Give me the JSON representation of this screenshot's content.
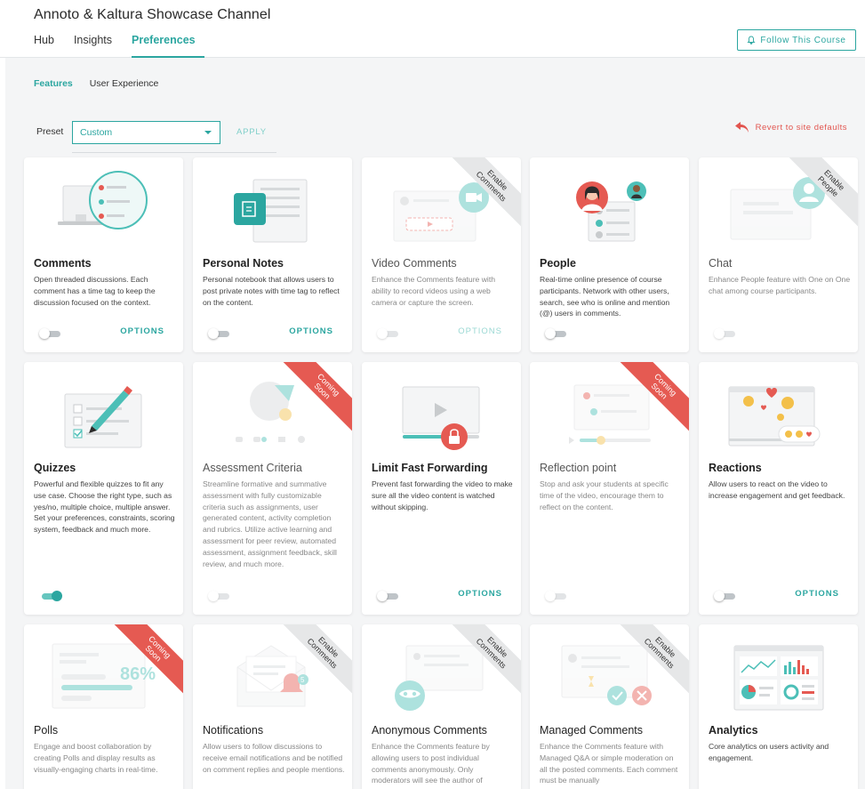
{
  "channel": {
    "title": "Annoto & Kaltura Showcase Channel"
  },
  "nav": {
    "tabs": [
      "Hub",
      "Insights",
      "Preferences"
    ],
    "active": "Preferences"
  },
  "follow_button": {
    "label": "Follow This Course"
  },
  "subtabs": {
    "features": "Features",
    "user_experience": "User Experience"
  },
  "preset": {
    "label": "Preset",
    "value": "Custom",
    "apply": "APPLY",
    "revert": "Revert to site defaults"
  },
  "options_label": "OPTIONS",
  "colors": {
    "accent": "#2ba6a0",
    "danger": "#e55a52",
    "ribbon_gray": "#e6e7e8",
    "background": "#f4f5f6"
  },
  "cards": [
    {
      "title": "Comments",
      "desc": "Open threaded discussions. Each comment has a time tag to keep the discussion focused on the context.",
      "toggle": "off",
      "options": true,
      "icon": "comments-illustration"
    },
    {
      "title": "Personal Notes",
      "desc": "Personal notebook that allows users to post private notes with time tag to reflect on the content.",
      "toggle": "off",
      "options": true,
      "icon": "notes-illustration"
    },
    {
      "title": "Video Comments",
      "desc": "Enhance the Comments feature with ability to record videos using a web camera or capture the screen.",
      "toggle": "off",
      "options": true,
      "ribbon": "Enable Comments",
      "icon": "video-comments-illustration"
    },
    {
      "title": "People",
      "desc": "Real-time online presence of course participants. Network with other users, search, see who is online and mention (@) users in comments.",
      "toggle": "off",
      "options": false,
      "icon": "people-illustration"
    },
    {
      "title": "Chat",
      "desc": "Enhance People feature with One on One chat among course participants.",
      "toggle": "off",
      "options": false,
      "ribbon": "Enable People",
      "icon": "chat-illustration"
    },
    {
      "title": "Quizzes",
      "desc": "Powerful and flexible quizzes to fit any use case. Choose the right type, such as yes/no, multiple choice, multiple answer. Set your preferences, constraints, scoring system, feedback and much more.",
      "toggle": "on",
      "options": false,
      "icon": "quizzes-illustration"
    },
    {
      "title": "Assessment Criteria",
      "desc": "Streamline formative and summative assessment with fully customizable criteria such as assignments, user generated content, activity completion and rubrics. Utilize active learning and assessment for peer review, automated assessment, assignment feedback, skill review, and much more.",
      "toggle": "off",
      "options": false,
      "ribbon": "Coming Soon",
      "icon": "assessment-illustration"
    },
    {
      "title": "Limit Fast Forwarding",
      "desc": "Prevent fast forwarding the video to make sure all the video content is watched without skipping.",
      "toggle": "off",
      "options": true,
      "icon": "lock-video-illustration"
    },
    {
      "title": "Reflection point",
      "desc": "Stop and ask your students at specific time of the video, encourage them to reflect on the content.",
      "toggle": "off",
      "options": false,
      "ribbon": "Coming Soon",
      "icon": "reflection-illustration"
    },
    {
      "title": "Reactions",
      "desc": "Allow users to react on the video to increase engagement and get feedback.",
      "toggle": "off",
      "options": true,
      "icon": "reactions-illustration"
    },
    {
      "title": "Polls",
      "desc": "Engage and boost collaboration by creating Polls and display results as visually-engaging charts in real-time.",
      "ribbon": "Coming Soon",
      "icon": "polls-illustration",
      "poll_value": "86%"
    },
    {
      "title": "Notifications",
      "desc": "Allow users to follow discussions to receive email notifications and be notified on comment replies and people mentions.",
      "ribbon": "Enable Comments",
      "icon": "notifications-illustration",
      "badge": "5"
    },
    {
      "title": "Anonymous Comments",
      "desc": "Enhance the Comments feature by allowing users to post individual comments anonymously. Only moderators will see the author of",
      "ribbon": "Enable Comments",
      "icon": "anonymous-illustration"
    },
    {
      "title": "Managed Comments",
      "desc": "Enhance the Comments feature with Managed Q&A or simple moderation on all the posted comments. Each comment must be manually",
      "ribbon": "Enable Comments",
      "icon": "managed-illustration"
    },
    {
      "title": "Analytics",
      "desc": "Core analytics on users activity and engagement.",
      "icon": "analytics-illustration"
    }
  ]
}
